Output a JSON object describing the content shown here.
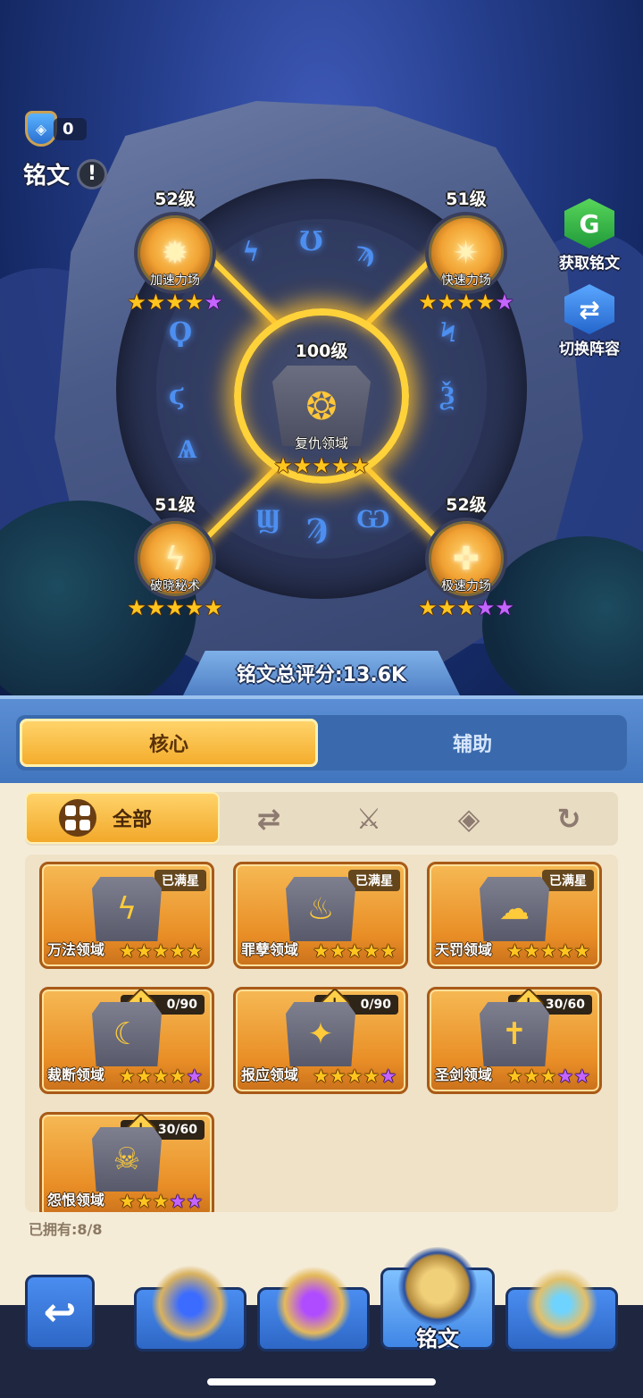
{
  "header": {
    "currency_value": "0",
    "title": "铭文"
  },
  "side_buttons": {
    "get": "获取铭文",
    "switch": "切换阵容"
  },
  "center_node": {
    "level": "100级",
    "name": "复仇领域",
    "stars": [
      "gold",
      "gold",
      "gold",
      "gold",
      "gold"
    ]
  },
  "nodes": [
    {
      "level": "52级",
      "name": "加速力场",
      "stars": [
        "gold",
        "gold",
        "gold",
        "gold",
        "purple"
      ]
    },
    {
      "level": "51级",
      "name": "快速力场",
      "stars": [
        "gold",
        "gold",
        "gold",
        "gold",
        "purple"
      ]
    },
    {
      "level": "51级",
      "name": "破晓秘术",
      "stars": [
        "gold",
        "gold",
        "gold",
        "gold",
        "gold"
      ]
    },
    {
      "level": "52级",
      "name": "极速力场",
      "stars": [
        "gold",
        "gold",
        "gold",
        "purple",
        "purple"
      ]
    }
  ],
  "score": "铭文总评分:13.6K",
  "tabs": {
    "core": "核心",
    "assist": "辅助"
  },
  "filter": {
    "all": "全部"
  },
  "cards": [
    {
      "name": "万法领域",
      "tag": "已满星",
      "stars": [
        "gold",
        "gold",
        "gold",
        "gold",
        "gold"
      ]
    },
    {
      "name": "罪孽领域",
      "tag": "已满星",
      "stars": [
        "gold",
        "gold",
        "gold",
        "gold",
        "gold"
      ]
    },
    {
      "name": "天罚领域",
      "tag": "已满星",
      "stars": [
        "gold",
        "gold",
        "gold",
        "gold",
        "gold"
      ]
    },
    {
      "name": "裁断领域",
      "progress": "0/90",
      "stars": [
        "gold",
        "gold",
        "gold",
        "gold",
        "purple"
      ]
    },
    {
      "name": "报应领域",
      "progress": "0/90",
      "stars": [
        "gold",
        "gold",
        "gold",
        "gold",
        "purple"
      ]
    },
    {
      "name": "圣剑领域",
      "progress": "30/60",
      "stars": [
        "gold",
        "gold",
        "gold",
        "purple",
        "purple"
      ]
    },
    {
      "name": "怨恨领域",
      "progress": "30/60",
      "stars": [
        "gold",
        "gold",
        "gold",
        "purple",
        "purple"
      ]
    }
  ],
  "owned": "已拥有:8/8",
  "nav": {
    "active_label": "铭文"
  },
  "colors": {
    "gold_star": "#ffc51f",
    "purple_star": "#c465ff",
    "accent": "#f4ad2c"
  }
}
